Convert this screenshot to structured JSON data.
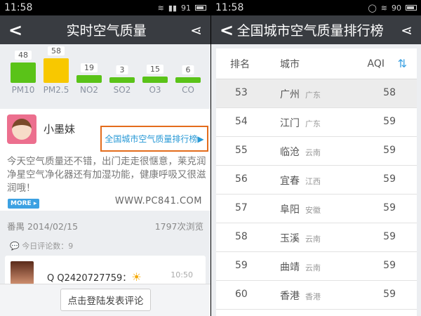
{
  "left": {
    "status": {
      "time": "11:58",
      "battery": "91"
    },
    "header": {
      "title": "实时空气质量",
      "back_icon": "‹",
      "share_icon": "share"
    },
    "pollutants": [
      {
        "name": "PM10",
        "value": 48,
        "color": "#5ac318"
      },
      {
        "name": "PM2.5",
        "value": 58,
        "color": "#f8c800"
      },
      {
        "name": "NO2",
        "value": 19,
        "color": "#5ac318"
      },
      {
        "name": "SO2",
        "value": 3,
        "color": "#5ac318"
      },
      {
        "name": "O3",
        "value": 15,
        "color": "#5ac318"
      },
      {
        "name": "CO",
        "value": 6,
        "color": "#5ac318"
      }
    ],
    "post": {
      "username": "小墨妹",
      "rank_link": "全国城市空气质量排行榜",
      "content": "今天空气质量还不错，出门走走很惬意，莱克润净星空气净化器还有加湿功能，健康呼吸又很滋润哦！",
      "more": "MORE",
      "watermark": "WWW.PC841.COM",
      "location_date": "番禺  2014/02/15",
      "views": "1797次浏览"
    },
    "comment_count": "今日评论数：9",
    "comment": {
      "name": "Q Q2420727759：",
      "time": "10:50"
    },
    "login_button": "点击登陆发表评论"
  },
  "right": {
    "status": {
      "time": "11:58",
      "battery": "90"
    },
    "header": {
      "title": "全国城市空气质量排行榜"
    },
    "columns": {
      "rank": "排名",
      "city": "城市",
      "aqi": "AQI"
    },
    "rows": [
      {
        "rank": "53",
        "city": "广州",
        "province": "广东",
        "aqi": "58"
      },
      {
        "rank": "54",
        "city": "江门",
        "province": "广东",
        "aqi": "59"
      },
      {
        "rank": "55",
        "city": "临沧",
        "province": "云南",
        "aqi": "59"
      },
      {
        "rank": "56",
        "city": "宜春",
        "province": "江西",
        "aqi": "59"
      },
      {
        "rank": "57",
        "city": "阜阳",
        "province": "安徽",
        "aqi": "59"
      },
      {
        "rank": "58",
        "city": "玉溪",
        "province": "云南",
        "aqi": "59"
      },
      {
        "rank": "59",
        "city": "曲靖",
        "province": "云南",
        "aqi": "59"
      },
      {
        "rank": "60",
        "city": "香港",
        "province": "香港",
        "aqi": "59"
      }
    ]
  }
}
